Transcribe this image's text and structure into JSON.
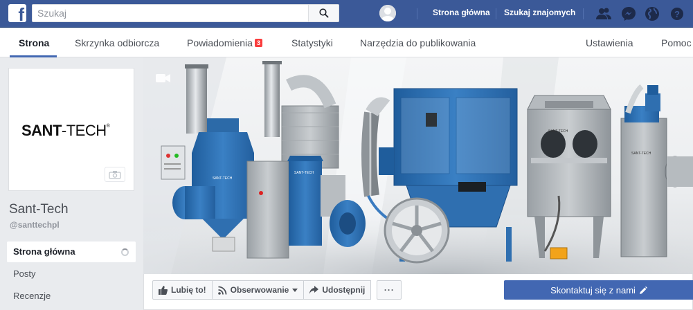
{
  "topbar": {
    "search_placeholder": "Szukaj",
    "home_label": "Strona główna",
    "find_friends_label": "Szukaj znajomych"
  },
  "subnav": {
    "tabs": [
      {
        "label": "Strona"
      },
      {
        "label": "Skrzynka odbiorcza"
      },
      {
        "label": "Powiadomienia",
        "badge": "3"
      },
      {
        "label": "Statystyki"
      },
      {
        "label": "Narzędzia do publikowania"
      },
      {
        "label": "Ustawienia"
      },
      {
        "label": "Pomoc"
      }
    ]
  },
  "page": {
    "logo_part1": "SANT",
    "logo_part2": "-TECH",
    "logo_reg": "®",
    "name": "Sant-Tech",
    "handle": "@santtechpl"
  },
  "leftnav": {
    "items": [
      {
        "label": "Strona główna"
      },
      {
        "label": "Posty"
      },
      {
        "label": "Recenzje"
      }
    ]
  },
  "actions": {
    "like": "Lubię to!",
    "follow": "Obserwowanie",
    "share": "Udostępnij",
    "more": "···",
    "contact": "Skontaktuj się z nami"
  },
  "cover": {
    "machine_label_1": "SANT-TECH",
    "machine_label_2": "SANT-TECH",
    "machine_label_3": "SANT-TECH",
    "machine_label_4": "SANT-TECH"
  },
  "colors": {
    "brand_blue": "#3b5998",
    "cta_blue": "#4267b2",
    "machine_blue": "#2f6fb0",
    "badge_red": "#fa3e3e"
  }
}
